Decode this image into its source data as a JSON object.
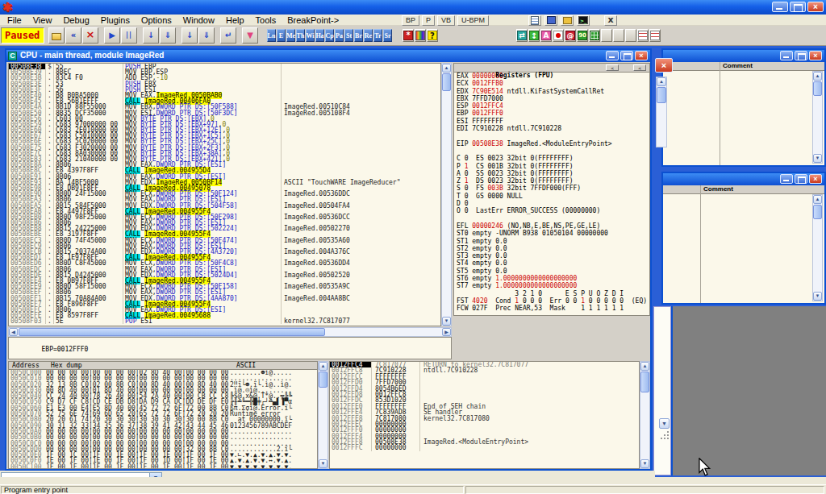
{
  "menu": {
    "items": [
      "File",
      "View",
      "Debug",
      "Plugins",
      "Options",
      "Window",
      "Help",
      "Tools",
      "BreakPoint->"
    ]
  },
  "plugin_bar": {
    "buttons": [
      "BP",
      "P",
      "VB",
      "U-BPM"
    ],
    "icons": [
      "notepad-icon",
      "book-icon",
      "folder-icon",
      "console-icon"
    ],
    "close_label": "x"
  },
  "toolbar": {
    "paused": "Paused",
    "run_icons": [
      "open-folder-icon",
      "go-back-icon",
      "close-window-icon",
      "|",
      "run-icon",
      "pause-icon",
      "|",
      "step-into-icon",
      "step-over-icon",
      "|",
      "animate-into-icon",
      "animate-over-icon",
      "|",
      "execute-return-icon",
      "|",
      "trace-icon"
    ],
    "letters": [
      "Ln",
      "E",
      "Me",
      "Th",
      "Wi",
      "Ha",
      "Cp",
      "Pa",
      "St",
      "Br",
      "Re",
      "Tr",
      "Sr"
    ],
    "tool_icons": [
      "gear-icon",
      "rainbow-icon",
      "help-icon"
    ],
    "color_icons": [
      "sync-icon",
      "updown-icon",
      "letter-a-icon",
      "record-icon",
      "spiral-icon",
      "digits-icon",
      "window-grid-icon",
      "blank",
      "blank",
      "blank",
      "list-cols-icon",
      "list-rows-icon"
    ]
  },
  "cpu": {
    "title": "CPU - main thread, module ImageRed",
    "icon": "C"
  },
  "disasm": {
    "selected": 0,
    "rows": [
      [
        "00508E38",
        "$",
        "55",
        "PUSH EBP",
        ""
      ],
      [
        "00508E39",
        ".",
        "8BEC",
        "MOV EBP,ESP",
        ""
      ],
      [
        "00508E3B",
        ".",
        "83C4 F0",
        "ADD ESP,-10",
        ""
      ],
      [
        "00508E3E",
        ".",
        "53",
        "PUSH EBX",
        ""
      ],
      [
        "00508E3F",
        ".",
        "56",
        "PUSH ESI",
        ""
      ],
      [
        "00508E40",
        ".",
        "B8 B0BA5000",
        "MOV EAX,ImageRed.0050BAB0",
        ""
      ],
      [
        "00508E45",
        ".",
        "E8 56B1EFFF",
        "CALL ImageRed.00406FA0",
        ""
      ],
      [
        "00508E4A",
        ".",
        "8B1D 88F55000",
        "MOV EBX,DWORD PTR DS:[50F588]",
        "ImageRed.00510C84"
      ],
      [
        "00508E50",
        ".",
        "8B35 DCF35000",
        "MOV ESI,DWORD PTR DS:[50F3DC]",
        "ImageRed.005108F4"
      ],
      [
        "00508E56",
        ".",
        "C603 00",
        "MOV BYTE PTR DS:[EBX],0",
        ""
      ],
      [
        "00508E59",
        ".",
        "C683 97000000 00",
        "MOV BYTE PTR DS:[EBX+97],0",
        ""
      ],
      [
        "00508E60",
        ".",
        "C683 2E010000 00",
        "MOV BYTE PTR DS:[EBX+12E],0",
        ""
      ],
      [
        "00508E67",
        ".",
        "C683 C5010000 00",
        "MOV BYTE PTR DS:[EBX+1C5],0",
        ""
      ],
      [
        "00508E6E",
        ".",
        "C683 5C020000 00",
        "MOV BYTE PTR DS:[EBX+25C],0",
        ""
      ],
      [
        "00508E75",
        ".",
        "C683 F3020000 00",
        "MOV BYTE PTR DS:[EBX+2F3],0",
        ""
      ],
      [
        "00508E7C",
        ".",
        "C683 8A030000 00",
        "MOV BYTE PTR DS:[EBX+38A],0",
        ""
      ],
      [
        "00508E83",
        ".",
        "C683 21040000 00",
        "MOV BYTE PTR DS:[EBX+421],0",
        ""
      ],
      [
        "00508E8A",
        ".",
        "8B06",
        "MOV EAX,DWORD PTR DS:[ESI]",
        ""
      ],
      [
        "00508E8C",
        ".",
        "E8 4397F8FF",
        "CALL ImageRed.004955D4",
        ""
      ],
      [
        "00508E91",
        ".",
        "8B06",
        "MOV EAX,DWORD PTR DS:[ESI]",
        ""
      ],
      [
        "00508E93",
        ".",
        "BA 14BF5000",
        "MOV EDX,ImageRed.0050BF14",
        "ASCII \"TouchWARE ImageReducer\""
      ],
      [
        "00508E98",
        ".",
        "E8 DB91F8FF",
        "CALL ImageRed.00495078",
        ""
      ],
      [
        "00508E9D",
        ".",
        "8B0D 24F15000",
        "MOV ECX,DWORD PTR DS:[50F124]",
        "ImageRed.00536DDC"
      ],
      [
        "00508EA3",
        ".",
        "8B06",
        "MOV EAX,DWORD PTR DS:[ESI]",
        ""
      ],
      [
        "00508EA5",
        ".",
        "8B15 584F5000",
        "MOV EDX,DWORD PTR DS:[504F58]",
        "ImageRed.00504FA4"
      ],
      [
        "00508EAB",
        ".",
        "E8 4497F8FF",
        "CALL ImageRed.004955F4",
        ""
      ],
      [
        "00508EB0",
        ".",
        "8B0D 98F25000",
        "MOV ECX,DWORD PTR DS:[50F298]",
        "ImageRed.00536DCC"
      ],
      [
        "00508EB6",
        ".",
        "8B06",
        "MOV EAX,DWORD PTR DS:[ESI]",
        ""
      ],
      [
        "00508EB8",
        ".",
        "8B15 24225000",
        "MOV EDX,DWORD PTR DS:[502224]",
        "ImageRed.00502270"
      ],
      [
        "00508EBE",
        ".",
        "E8 3197F8FF",
        "CALL ImageRed.004955F4",
        ""
      ],
      [
        "00508EC3",
        ".",
        "8B0D 74F45000",
        "MOV ECX,DWORD PTR DS:[50F474]",
        "ImageRed.00535A60"
      ],
      [
        "00508EC9",
        ".",
        "8B06",
        "MOV EAX,DWORD PTR DS:[ESI]",
        ""
      ],
      [
        "00508ECB",
        ".",
        "8B15 20374A00",
        "MOV EDX,DWORD PTR DS:[4A3720]",
        "ImageRed.004A376C"
      ],
      [
        "00508ED1",
        ".",
        "E8 1E97F8FF",
        "CALL ImageRed.004955F4",
        ""
      ],
      [
        "00508ED6",
        ".",
        "8B0D C8F45000",
        "MOV ECX,DWORD PTR DS:[50F4C8]",
        "ImageRed.00536DD4"
      ],
      [
        "00508EDC",
        ".",
        "8B06",
        "MOV EAX,DWORD PTR DS:[ESI]",
        ""
      ],
      [
        "00508EDE",
        ".",
        "8B15 D4245000",
        "MOV EDX,DWORD PTR DS:[5024D4]",
        "ImageRed.00502520"
      ],
      [
        "00508EE4",
        ".",
        "E8 0B97F8FF",
        "CALL ImageRed.004955F4",
        ""
      ],
      [
        "00508EE9",
        ".",
        "8B0D 58F15000",
        "MOV ECX,DWORD PTR DS:[50F158]",
        "ImageRed.00535A9C"
      ],
      [
        "00508EEF",
        ".",
        "8B06",
        "MOV EAX,DWORD PTR DS:[ESI]",
        ""
      ],
      [
        "00508EF1",
        ".",
        "8B15 70A84A00",
        "MOV EDX,DWORD PTR DS:[4AA870]",
        "ImageRed.004AA8BC"
      ],
      [
        "00508EF7",
        ".",
        "E8 F896F8FF",
        "CALL ImageRed.004955F4",
        ""
      ],
      [
        "00508EFC",
        ".",
        "8B06",
        "MOV EAX,DWORD PTR DS:[ESI]",
        ""
      ],
      [
        "00508EFE",
        ".",
        "E8 8597F8FF",
        "CALL ImageRed.00495688",
        ""
      ],
      [
        "00508F03",
        ".",
        "5E",
        "POP ESI",
        "kernel32.7C817077"
      ]
    ]
  },
  "info": {
    "text": "EBP=0012FFF0"
  },
  "registers": {
    "title": "Registers (FPU)",
    "lines": [
      [
        [
          "EAX ",
          "n"
        ],
        [
          "00000000",
          "r"
        ]
      ],
      [
        [
          "ECX ",
          "n"
        ],
        [
          "0012FFB0",
          "r"
        ]
      ],
      [
        [
          "EDX ",
          "n"
        ],
        [
          "7C90E514",
          "r"
        ],
        [
          " ntdll.KiFastSystemCallRet",
          "n"
        ]
      ],
      [
        [
          "EBX 7FFD7000",
          "n"
        ]
      ],
      [
        [
          "ESP ",
          "n"
        ],
        [
          "0012FFC4",
          "r"
        ]
      ],
      [
        [
          "EBP ",
          "n"
        ],
        [
          "0012FFF0",
          "r"
        ]
      ],
      [
        [
          "ESI FFFFFFFF",
          "n"
        ]
      ],
      [
        [
          "EDI 7C910228 ntdll.7C910228",
          "n"
        ]
      ],
      [],
      [
        [
          "EIP ",
          "n"
        ],
        [
          "00508E38",
          "r"
        ],
        [
          " ImageRed.<ModuleEntryPoint>",
          "n"
        ]
      ],
      [],
      [
        [
          "C 0  ES 0023 32bit 0(FFFFFFFF)",
          "n"
        ]
      ],
      [
        [
          "P ",
          "n"
        ],
        [
          "1",
          "r"
        ],
        [
          "  CS 001B 32bit 0(FFFFFFFF)",
          "n"
        ]
      ],
      [
        [
          "A 0  SS 0023 32bit 0(FFFFFFFF)",
          "n"
        ]
      ],
      [
        [
          "Z ",
          "n"
        ],
        [
          "1",
          "r"
        ],
        [
          "  DS 0023 32bit 0(FFFFFFFF)",
          "n"
        ]
      ],
      [
        [
          "S 0  FS ",
          "n"
        ],
        [
          "003B",
          "r"
        ],
        [
          " 32bit 7FFDF000(FFF)",
          "n"
        ]
      ],
      [
        [
          "T 0  GS 0000 NULL",
          "n"
        ]
      ],
      [
        [
          "D 0",
          "n"
        ]
      ],
      [
        [
          "O 0  LastErr ERROR_SUCCESS (00000000)",
          "n"
        ]
      ],
      [],
      [
        [
          "EFL ",
          "n"
        ],
        [
          "00000246",
          "r"
        ],
        [
          " (NO,NB,E,BE,NS,PE,GE,LE)",
          "n"
        ]
      ],
      [
        [
          "ST0 empty -UNORM B938 01050104 00000000",
          "n"
        ]
      ],
      [
        [
          "ST1 empty 0.0",
          "n"
        ]
      ],
      [
        [
          "ST2 empty 0.0",
          "n"
        ]
      ],
      [
        [
          "ST3 empty 0.0",
          "n"
        ]
      ],
      [
        [
          "ST4 empty 0.0",
          "n"
        ]
      ],
      [
        [
          "ST5 empty 0.0",
          "n"
        ]
      ],
      [
        [
          "ST6 empty ",
          "n"
        ],
        [
          "1.0000000000000000000",
          "r"
        ]
      ],
      [
        [
          "ST7 empty ",
          "n"
        ],
        [
          "1.0000000000000000000",
          "r"
        ]
      ],
      [
        [
          "               3 2 1 0      E S P U O Z D I",
          "n"
        ]
      ],
      [
        [
          "FST ",
          "n"
        ],
        [
          "4020",
          "r"
        ],
        [
          "  Cond ",
          "n"
        ],
        [
          "1",
          "r"
        ],
        [
          " 0 0 0  Err 0 0 ",
          "n"
        ],
        [
          "1",
          "r"
        ],
        [
          " 0 0 0 0 0  (EQ)",
          "n"
        ]
      ],
      [
        [
          "FCW 027F  Prec NEAR,53  Mask    1 1 1 1 1 1",
          "n"
        ]
      ]
    ]
  },
  "stack": {
    "selected": 0,
    "rows": [
      [
        "0012FFC4",
        "7C817077",
        "RETURN to kernel32.7C817077"
      ],
      [
        "0012FFC8",
        "7C910228",
        "ntdll.7C910228"
      ],
      [
        "0012FFCC",
        "FFFFFFFF",
        ""
      ],
      [
        "0012FFD0",
        "7FFD7000",
        ""
      ],
      [
        "0012FFD4",
        "8054B6ED",
        ""
      ],
      [
        "0012FFD8",
        "0012FFC8",
        ""
      ],
      [
        "0012FFDC",
        "853D1020",
        ""
      ],
      [
        "0012FFE0",
        "FFFFFFFF",
        "End of SEH chain"
      ],
      [
        "0012FFE4",
        "7C839AD8",
        "SE handler"
      ],
      [
        "0012FFE8",
        "7C817080",
        "kernel32.7C817080"
      ],
      [
        "0012FFEC",
        "00000000",
        ""
      ],
      [
        "0012FFF0",
        "00000000",
        ""
      ],
      [
        "0012FFF4",
        "00000000",
        ""
      ],
      [
        "0012FFF8",
        "00508E38",
        "ImageRed.<ModuleEntryPoint>"
      ],
      [
        "0012FFFC",
        "00000000",
        ""
      ]
    ]
  },
  "hex": {
    "headers": [
      "Address",
      "Hex dump",
      "ASCII"
    ],
    "rows": [
      [
        "0050C000",
        "00 00 00 00|00 00 00 00|02 8D 40 00|00 00 00 00",
        "........☻ì@....."
      ],
      [
        "0050C010",
        "00 00 00 00|00 00 00 00|00 00 00 00|00 00 00 00",
        "................"
      ],
      [
        "0050C020",
        "32 13 8B C0|02 00 8B C0|00 8D 40 00|00 8D 40 00",
        "2‼ï└☻.ï└.ì@..ì@."
      ],
      [
        "0050C030",
        "00 8D 40 00|01 8D 40 00|00 00 00 00|00 00 00 00",
        ".ì@.☺ì@........."
      ],
      [
        "0050C040",
        "CC 24 40 00|78 26 40 00|54 2A 40 00|00 CB CC C8",
        "╠$@.x&@.T*@..╦╠╚"
      ],
      [
        "0050C050",
        "C9 D7 CF C8|CD CE DB D8|DA D9 CA DC|DD DE DF E0",
        "╔╫╧╚═╬█╪┌┘╩▄▌▐▀α"
      ],
      [
        "0050C060",
        "E1 E3 00 E4|E5 8D 40 00|45 72 72 6F|72 00 8B C0",
        "ßπ.Σσì@.Error.ï└"
      ],
      [
        "0050C070",
        "52 75 6E 74|69 6D 65 20|65 72 72 6F|72 20 20 20",
        "Runtime error   "
      ],
      [
        "0050C080",
        "20 20 61 74|20 30 30 30|30 30 30 30|30 00 8B C0",
        "  at 00000000.ï└"
      ],
      [
        "0050C090",
        "30 31 32 33|34 35 36 37|38 39 41 42|43 44 45 46",
        "0123456789ABCDEF"
      ],
      [
        "0050C0A0",
        "00 00 00 00|00 00 00 00|00 00 00 00|00 00 00 00",
        "................"
      ],
      [
        "0050C0B0",
        "00 00 00 00|00 00 00 00|00 00 00 00|00 00 00 00",
        "................"
      ],
      [
        "0050C0C0",
        "00 00 00 00|00 00 00 00|00 00 00 00|00 00 00 00",
        "................"
      ],
      [
        "0050C0D0",
        "00 00 00 00|00 00 00 00|00 00 00 00|32 00 8B C0",
        "............2.ï└"
      ],
      [
        "0050C0E0",
        "1F 00 1C 00|1F 00 1E 00|1F 00 1E 00|1F 00 1F 00",
        "▼.∟.▼.▲.▼.▲.▼.▼."
      ],
      [
        "0050C0F0",
        "1E 00 1F 00|1E 00 1F 00|1F 00 1D 00|1F 00 1E 00",
        "▲.▼.▲.▼.▼.↔.▼.▲."
      ],
      [
        "0050C100",
        "1F 00 1F 00|1F 00 1F 00|1F 00 1F 00|1F 00 1F 00",
        "▼.▼.▼.▼.▼.▼.▼.▼."
      ]
    ]
  },
  "right_windows": {
    "comment_header": "Comment"
  },
  "command": {
    "value": ""
  },
  "statusbar": {
    "left": "Program entry point",
    "right": ""
  }
}
